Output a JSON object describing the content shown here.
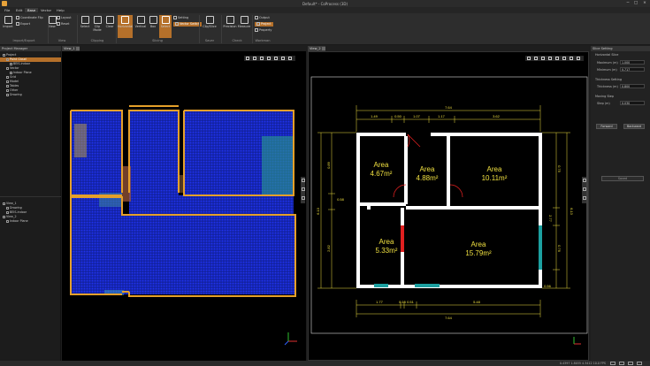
{
  "window": {
    "title": "Default* - CoProcess (3D)",
    "controls": [
      "−",
      "□",
      "×"
    ]
  },
  "menu": [
    "File",
    "Edit",
    "Base",
    "Vector",
    "Help"
  ],
  "ribbon": {
    "import_export": {
      "label": "Import/Export",
      "import": "Import",
      "coordinate_flip": "Coordinate Flip",
      "export": "Export"
    },
    "view": {
      "label": "View",
      "new": "New",
      "layout": "Layout",
      "reset": "Reset"
    },
    "clipping": {
      "label": "Clipping",
      "select": "Select",
      "clip_mode": "Clip Mode",
      "clear": "Clear",
      "delete": "Delete"
    },
    "slicing": {
      "label": "Slicing",
      "horizontal": "Horizontal",
      "vertical": "Vertical",
      "box": "Box",
      "select": "Select",
      "setting": "Setting",
      "vector_switch": "Vector Switch"
    },
    "saver": {
      "label": "Saver",
      "clip_slice": "Clip/Slice"
    },
    "check": {
      "label": "Check",
      "precision": "Precision",
      "measure": "Measure"
    },
    "workman": {
      "label": "Workman",
      "output": "Output",
      "project": "Project",
      "property": "Property"
    }
  },
  "project_manager": {
    "title": "Project Manager",
    "tree": [
      {
        "label": "Project",
        "level": 0,
        "selected": false
      },
      {
        "label": "Point Cloud",
        "level": 1,
        "selected": true
      },
      {
        "label": "BEIS-indoor",
        "level": 2,
        "selected": false
      },
      {
        "label": "Vector",
        "level": 1,
        "selected": false
      },
      {
        "label": "Indoor Plane",
        "level": 2,
        "selected": false
      },
      {
        "label": "Grid",
        "level": 1,
        "selected": false
      },
      {
        "label": "Model",
        "level": 1,
        "selected": false
      },
      {
        "label": "Tables",
        "level": 1,
        "selected": false
      },
      {
        "label": "Other",
        "level": 1,
        "selected": false
      },
      {
        "label": "Drawing",
        "level": 1,
        "selected": false
      }
    ],
    "tree2": [
      {
        "label": "View_1",
        "level": 0
      },
      {
        "label": "Drawing",
        "level": 1
      },
      {
        "label": "BEIS-indoor",
        "level": 1
      },
      {
        "label": "View_2",
        "level": 0
      },
      {
        "label": "Indoor Plane",
        "level": 1
      }
    ]
  },
  "view1": {
    "tab": "View_1"
  },
  "view2": {
    "tab": "View_2"
  },
  "plan": {
    "top_total": "7.64",
    "top_dims": [
      "1.49",
      "0.50",
      "1.07",
      "1.17",
      "3.62"
    ],
    "bottom_dims": [
      "1.77",
      "0.15",
      "0.51",
      "5.48"
    ],
    "bottom_total": "7.64",
    "left_total": "6.13",
    "left_dims": [
      "0.89",
      "0.58",
      "2.82"
    ],
    "right_total": "6.13",
    "right_dims": [
      "0.75",
      "2.77",
      "0.76",
      "0.56"
    ],
    "rooms": [
      {
        "label": "Area",
        "value": "4.67m²"
      },
      {
        "label": "Area",
        "value": "4.88m²"
      },
      {
        "label": "Area",
        "value": "10.11m²"
      },
      {
        "label": "Area",
        "value": "5.33m²"
      },
      {
        "label": "Area",
        "value": "15.79m²"
      }
    ]
  },
  "slice_setting": {
    "title": "Slice Setting",
    "horizontal_slice": "Horizontal Slice",
    "maximum_label": "Maximum (m)",
    "maximum_value": "1.000",
    "minimum_label": "Minimum (m)",
    "minimum_value": "0.717",
    "thickness_setting": "Thickness Setting",
    "thickness_label": "Thickness (m)",
    "thickness_value": "0.800",
    "moving_step": "Moving Step",
    "step_label": "Step (m)",
    "step_value": "0.030",
    "forward": "Forward",
    "backward": "Backward",
    "saved": "Saved"
  },
  "status": {
    "text": "0.4397 1.8035 4.3412 10.0 FPS"
  },
  "colors": {
    "accent": "#b5702a",
    "wall_yellow": "#e5a02a",
    "cloud_blue": "#1a2fd6"
  }
}
